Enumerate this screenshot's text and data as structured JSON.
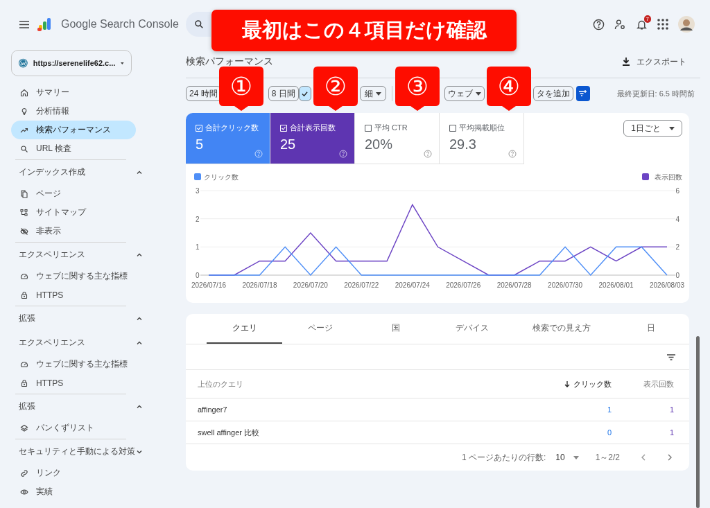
{
  "header": {
    "product": "Google Search Console",
    "notification_count": "7"
  },
  "sidebar": {
    "property": "https://serenelife62.c...",
    "groups": [
      {
        "items": [
          {
            "label": "サマリー",
            "selected": false
          },
          {
            "label": "分析情報",
            "selected": false
          },
          {
            "label": "検索パフォーマンス",
            "selected": true
          },
          {
            "label": "URL 検査",
            "selected": false
          }
        ]
      },
      {
        "title": "インデックス作成",
        "expanded": true,
        "items": [
          {
            "label": "ページ",
            "selected": false
          },
          {
            "label": "サイトマップ",
            "selected": false
          },
          {
            "label": "非表示",
            "selected": false
          }
        ]
      },
      {
        "title": "エクスペリエンス",
        "expanded": true,
        "items": [
          {
            "label": "ウェブに関する主な指標",
            "selected": false
          },
          {
            "label": "HTTPS",
            "selected": false
          }
        ]
      },
      {
        "title": "拡張",
        "expanded": true
      },
      {
        "title": "エクスペリエンス",
        "expanded": true,
        "items": [
          {
            "label": "ウェブに関する主な指標",
            "selected": false
          },
          {
            "label": "HTTPS",
            "selected": false
          }
        ]
      },
      {
        "title": "拡張",
        "expanded": true,
        "items": [
          {
            "label": "パンくずリスト",
            "selected": false
          }
        ]
      },
      {
        "title": "セキュリティと手動による対策",
        "expanded": false
      },
      {
        "items": [
          {
            "label": "リンク",
            "selected": false
          },
          {
            "label": "実績",
            "selected": false
          }
        ]
      }
    ]
  },
  "page": {
    "title": "検索パフォーマンス",
    "export": "エクスポート",
    "last_updated": "最終更新日: 6.5 時間前"
  },
  "date_range": [
    {
      "label": "24 時間",
      "selected": false
    },
    {
      "label": "8 日間",
      "selected": false
    },
    {
      "selected": true
    },
    {
      "label": "細",
      "selected": false
    }
  ],
  "search_type": "ウェブ",
  "add_filter": "タを追加",
  "metrics": [
    {
      "label": "合計クリック数",
      "value": "5",
      "selected": true,
      "color": "#4285f4"
    },
    {
      "label": "合計表示回数",
      "value": "25",
      "selected": true,
      "color": "#5e35b1"
    },
    {
      "label": "平均 CTR",
      "value": "20%",
      "selected": false
    },
    {
      "label": "平均掲載順位",
      "value": "29.3",
      "selected": false
    }
  ],
  "interval": "1日ごと",
  "chart": {
    "chart_data": {
      "type": "line",
      "legend": "top",
      "ylim": [
        0,
        3
      ],
      "yticks": [
        0,
        1,
        2,
        3
      ],
      "y2lim": [
        0,
        6
      ],
      "y2ticks": [
        0,
        2,
        4,
        6
      ],
      "categories": [
        "2026/07/16",
        null,
        "2026/07/18",
        null,
        "2026/07/20",
        null,
        "2026/07/22",
        null,
        "2026/07/24",
        null,
        "2026/07/26",
        null,
        "2026/07/28",
        null,
        "2026/07/30",
        null,
        "2026/08/01",
        null,
        "2026/08/03"
      ],
      "series": [
        {
          "name": "クリック数",
          "color": "#4f8ff7",
          "values": [
            0,
            0,
            0,
            1,
            0,
            1,
            0,
            0,
            0,
            0,
            0,
            0,
            0,
            0,
            1,
            0,
            1,
            1,
            0
          ]
        },
        {
          "name": "表示回数",
          "color": "#6c44c4",
          "axis": "y2",
          "values": [
            0,
            0,
            1,
            1,
            3,
            1,
            1,
            1,
            5,
            2,
            1,
            0,
            0,
            1,
            1,
            2,
            1,
            2,
            2
          ]
        }
      ]
    }
  },
  "table": {
    "tabs": [
      {
        "label": "クエリ",
        "selected": true
      },
      {
        "label": "ページ",
        "selected": false
      },
      {
        "label": "国",
        "selected": false
      },
      {
        "label": "デバイス",
        "selected": false
      },
      {
        "label": "検索での見え方",
        "selected": false
      },
      {
        "label": "日",
        "selected": false
      }
    ],
    "columns": [
      "上位のクエリ",
      "クリック数",
      "表示回数"
    ],
    "rows": [
      [
        "affinger7",
        "1",
        "1"
      ],
      [
        "swell affinger 比較",
        "0",
        "1"
      ]
    ],
    "rows_per_page_label": "1 ページあたりの行数:",
    "rows_per_page": "10",
    "range": "1～2/2"
  },
  "annotations": {
    "banner": "最初はこの４項目だけ確認",
    "callouts": [
      "①",
      "②",
      "③",
      "④"
    ]
  }
}
